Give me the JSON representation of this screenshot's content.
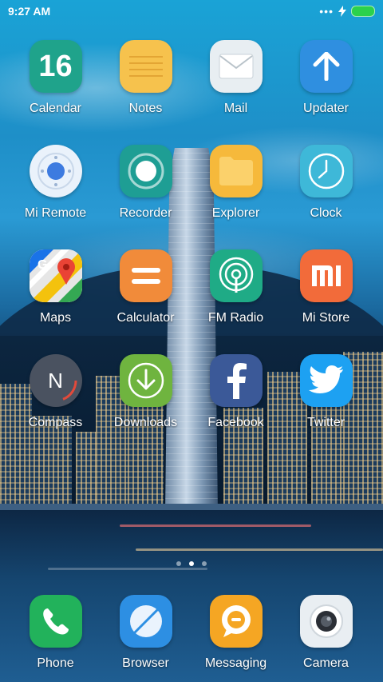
{
  "status_bar": {
    "time": "9:27 AM",
    "icons": [
      "more-dots-icon",
      "charging-bolt-icon",
      "battery-icon"
    ],
    "battery_color": "#2bd14d"
  },
  "pages": {
    "count": 3,
    "active_index": 1
  },
  "apps": [
    {
      "label": "Calendar",
      "icon": "calendar-icon",
      "badge": "16",
      "color": "#1fa38b"
    },
    {
      "label": "Notes",
      "icon": "notes-icon",
      "color": "#f6c24d"
    },
    {
      "label": "Mail",
      "icon": "mail-icon",
      "color": "#e8eef2"
    },
    {
      "label": "Updater",
      "icon": "updater-arrow-icon",
      "color": "#2f8fe0"
    },
    {
      "label": "Mi Remote",
      "icon": "remote-icon",
      "color": "#eaf2fb"
    },
    {
      "label": "Recorder",
      "icon": "recorder-icon",
      "color": "#1e9e94"
    },
    {
      "label": "Explorer",
      "icon": "folder-icon",
      "color": "#f6b93b"
    },
    {
      "label": "Clock",
      "icon": "clock-icon",
      "color": "#3eb8d8"
    },
    {
      "label": "Maps",
      "icon": "google-maps-icon",
      "color": "#ffffff"
    },
    {
      "label": "Calculator",
      "icon": "calculator-icon",
      "color": "#f18b3a"
    },
    {
      "label": "FM Radio",
      "icon": "radio-icon",
      "color": "#1fab86"
    },
    {
      "label": "Mi Store",
      "icon": "mi-logo-icon",
      "color": "#f26b3a"
    },
    {
      "label": "Compass",
      "icon": "compass-icon",
      "letter": "N",
      "color": "#4a5260"
    },
    {
      "label": "Downloads",
      "icon": "download-arrow-icon",
      "color": "#6fb43f"
    },
    {
      "label": "Facebook",
      "icon": "facebook-icon",
      "color": "#3b5998"
    },
    {
      "label": "Twitter",
      "icon": "twitter-bird-icon",
      "color": "#1da1f2"
    }
  ],
  "dock": [
    {
      "label": "Phone",
      "icon": "phone-icon",
      "color": "#22b25b"
    },
    {
      "label": "Browser",
      "icon": "browser-icon",
      "color": "#2d8fe3"
    },
    {
      "label": "Messaging",
      "icon": "messaging-icon",
      "color": "#f5a623"
    },
    {
      "label": "Camera",
      "icon": "camera-icon",
      "color": "#e9eef2"
    }
  ]
}
